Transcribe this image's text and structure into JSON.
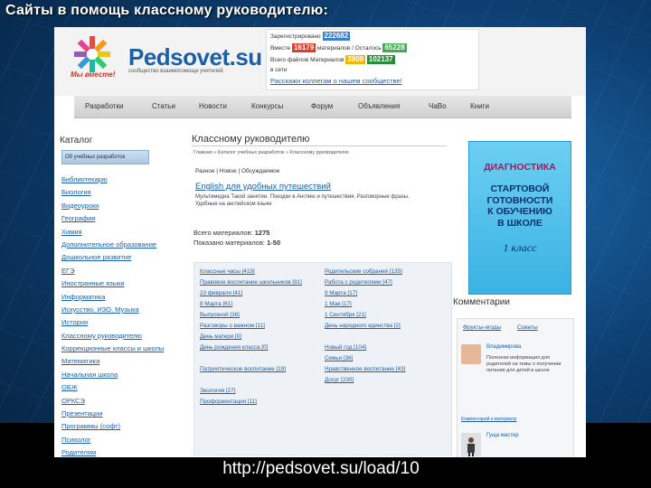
{
  "slide": {
    "title": "Сайты в помощь классному руководителю:",
    "url_caption": "http://pedsovet.su/load/10"
  },
  "site": {
    "logo_text": "Pedsovet.su",
    "logo_sub": "сообщество взаимопомощи учителей",
    "logo_slogan": "Мы вместе!",
    "stats": {
      "registered_label": "Зарегистрировано",
      "registered_value": "222682",
      "rows_text": "Вместе",
      "row2_label": "Вместе",
      "row2_value": "16179",
      "row2_mid": "материалов / Осталось",
      "row2_value2": "65228",
      "row3_label": "Всего файлов Материалов",
      "row3_value": "3809",
      "row3_value2": "102137",
      "row4_label": "в сети",
      "link": "Расскажи коллегам о нашем сообществе!"
    },
    "nav": [
      "Разработки",
      "Статьи",
      "Новости",
      "Конкурсы",
      "Форум",
      "Объявления",
      "ЧаВо",
      "Книги"
    ],
    "catalog": {
      "title": "Каталог",
      "button": "Об учебных разработок",
      "items": [
        "Библиотекарю",
        "Биология",
        "Видеоуроки",
        "География",
        "Химия",
        "Дополнительное образование",
        "Дошкольное развитие",
        "ЕГЭ",
        "Иностранные языки",
        "Информатика",
        "Искусство, ИЗО, Музыка",
        "История",
        "Классному руководителю",
        "Коррекционные классы и школы",
        "Математика",
        "Начальная школа",
        "ОБЖ",
        "ОРКСЭ",
        "Презентации",
        "Программы (софт)",
        "Психолог",
        "Родителям"
      ]
    },
    "main": {
      "title": "Классному руководителю",
      "small": "Главная » Каталог учебных разработок » Классному руководителю",
      "crumbs": "Разное | Новое | Обсуждаемое",
      "link": "English для удобных путешествий",
      "desc": "Мультимедиа Такой занятие. Поездки в Англию и путешествия, Разговорные фразы, Удобные на английском языке",
      "count_label": "Всего материалов:",
      "count_value": "1275",
      "shown_label": "Показано материалов:",
      "shown_value": "1-50"
    },
    "subcategories": {
      "left": [
        "Классные часы [419]",
        "Правовое воспитание школьников [91]",
        "23 февраля [41]",
        "8 Марта [61]",
        "Выпускной [36]",
        "Разговоры о важном [11]",
        "День матери [0]",
        "День рождения класса [0]",
        "Патриотическое воспитание [19]",
        "Экология [27]",
        "Профориентация [11]"
      ],
      "right": [
        "Родительские собрания [135]",
        "Работа с родителями [47]",
        "9 Марта [17]",
        "1 Мая [17]",
        "1 Сентября [21]",
        "День народного единства [2]",
        "Новый год [104]",
        "Семья [36]",
        "Нравственное воспитание [43]",
        "Досуг [230]"
      ]
    },
    "ad": {
      "head": "ДИАГНОСТИКА",
      "body": [
        "СТАРТОВОЙ",
        "ГОТОВНОСТИ",
        "К ОБУЧЕНИЮ",
        "В ШКОЛЕ"
      ],
      "foot": "1 класс"
    },
    "comments": {
      "title": "Комментарии",
      "tab1": "Фрукты-ягоды",
      "tab2": "Советы",
      "name1": "Владимирова",
      "text1": "Полезная информация для родителей на темы о получении питания для детей в школе",
      "link1": "Комментарий к материалу",
      "name2": "Гуща мастер"
    }
  }
}
